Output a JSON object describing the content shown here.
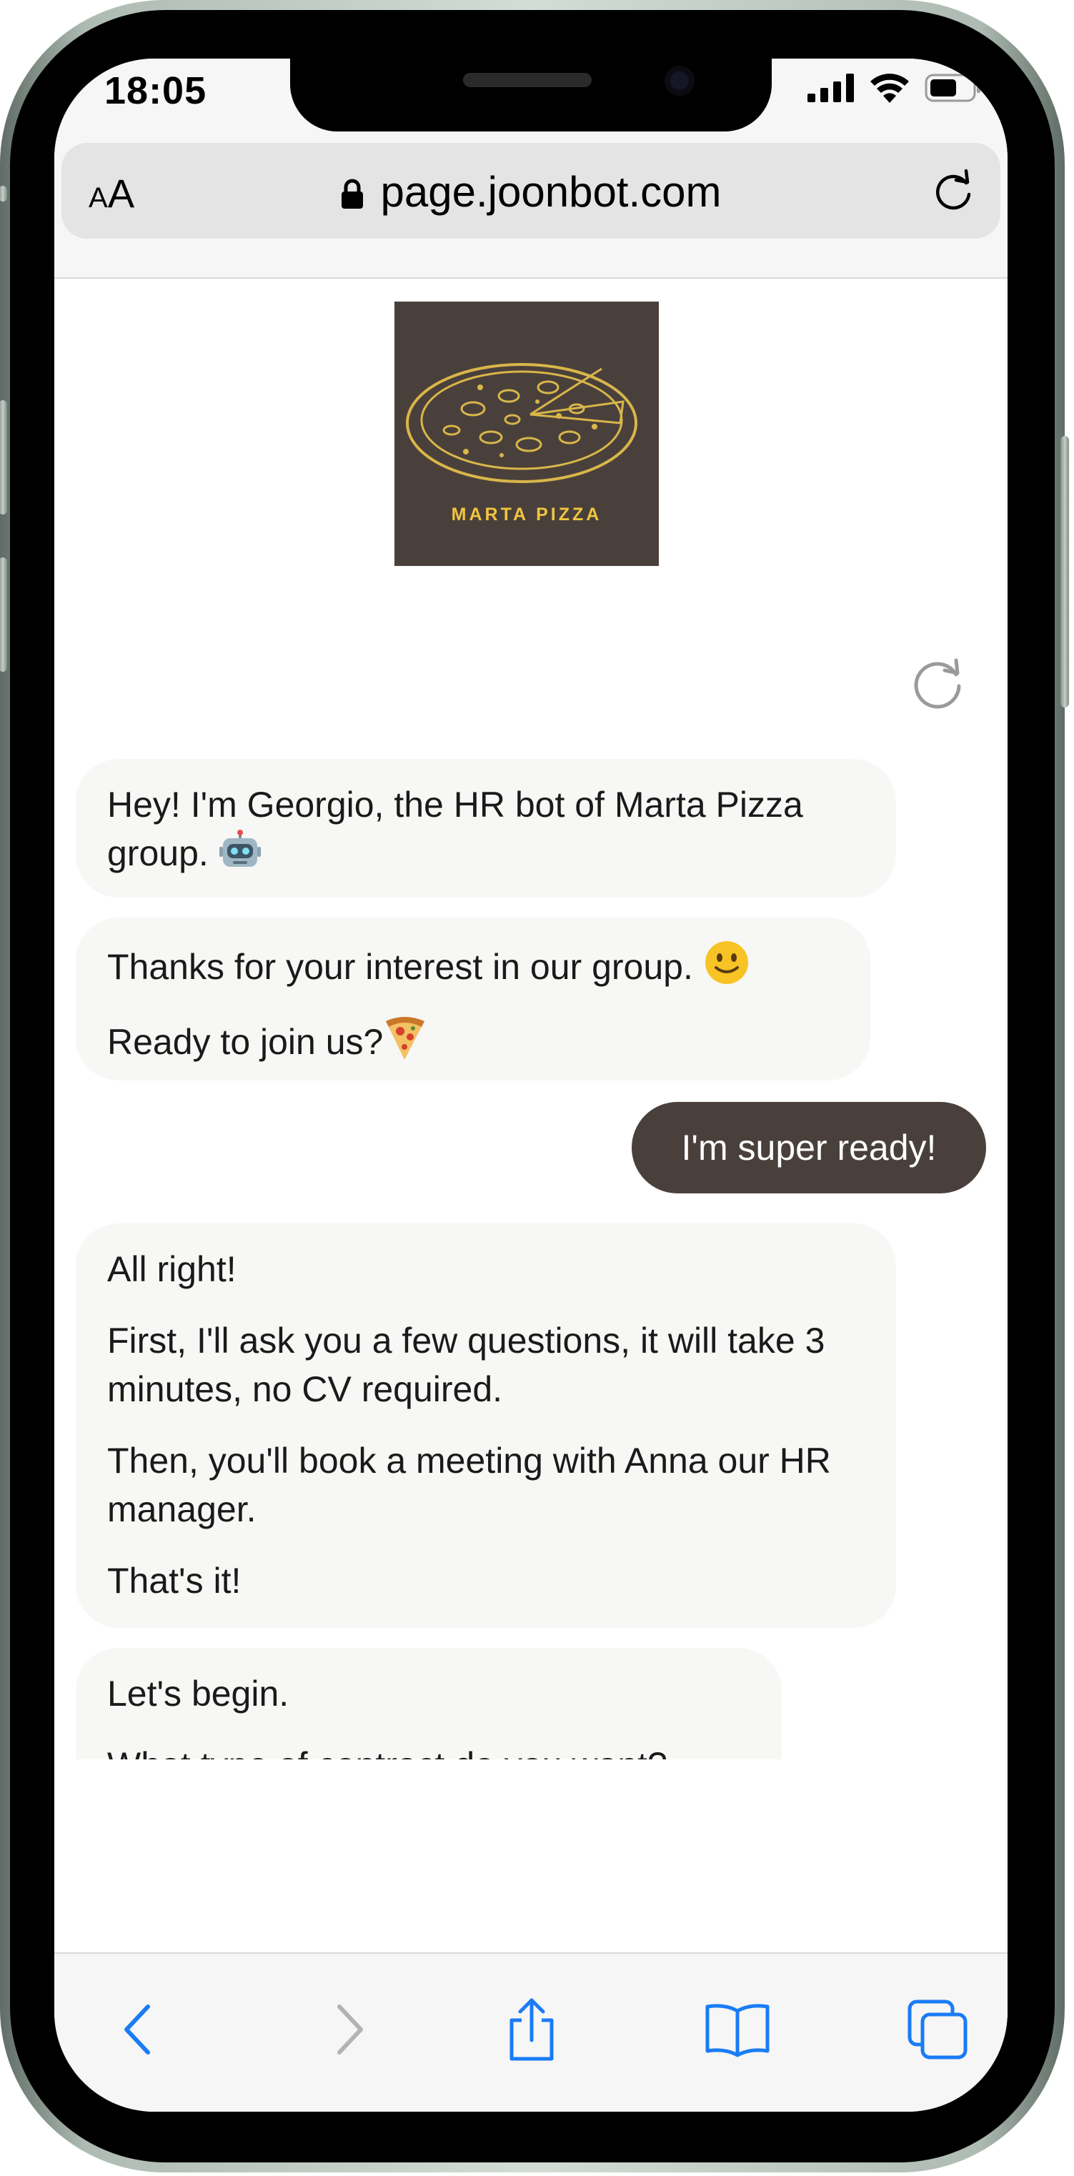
{
  "status_bar": {
    "time": "18:05"
  },
  "browser": {
    "text_size_label_small": "A",
    "text_size_label_large": "A",
    "url": "page.joonbot.com",
    "icons": {
      "lock": "lock-icon",
      "reload": "reload-icon"
    }
  },
  "brand": {
    "logo_text": "MARTA PIZZA",
    "logo_bg": "#4a403b",
    "logo_accent": "#f0c540"
  },
  "chat": {
    "bot_messages": [
      {
        "lines": [
          "Hey! I'm Georgio, the HR bot of Marta Pizza group."
        ],
        "emoji": "robot-emoji"
      },
      {
        "lines": [
          "Thanks for your interest in our group.",
          "Ready to join us?"
        ],
        "emojis": [
          "slightly-smiling-face-emoji",
          "pizza-emoji"
        ]
      },
      {
        "lines": [
          "All right!",
          "First, I'll ask you a few questions, it will take 3 minutes, no CV required.",
          "Then, you'll book a meeting with Anna our HR manager.",
          "That's it!"
        ]
      },
      {
        "lines": [
          "Let's begin.",
          "What type of contract do you want?"
        ]
      }
    ],
    "user_message": "I'm super ready!",
    "user_bubble_color": "#4a403b",
    "bot_bubble_color": "#f7f7f5"
  },
  "toolbar": {
    "icons": [
      "back-icon",
      "forward-icon",
      "share-icon",
      "bookmarks-icon",
      "tabs-icon"
    ],
    "accent": "#1a7cf5"
  }
}
